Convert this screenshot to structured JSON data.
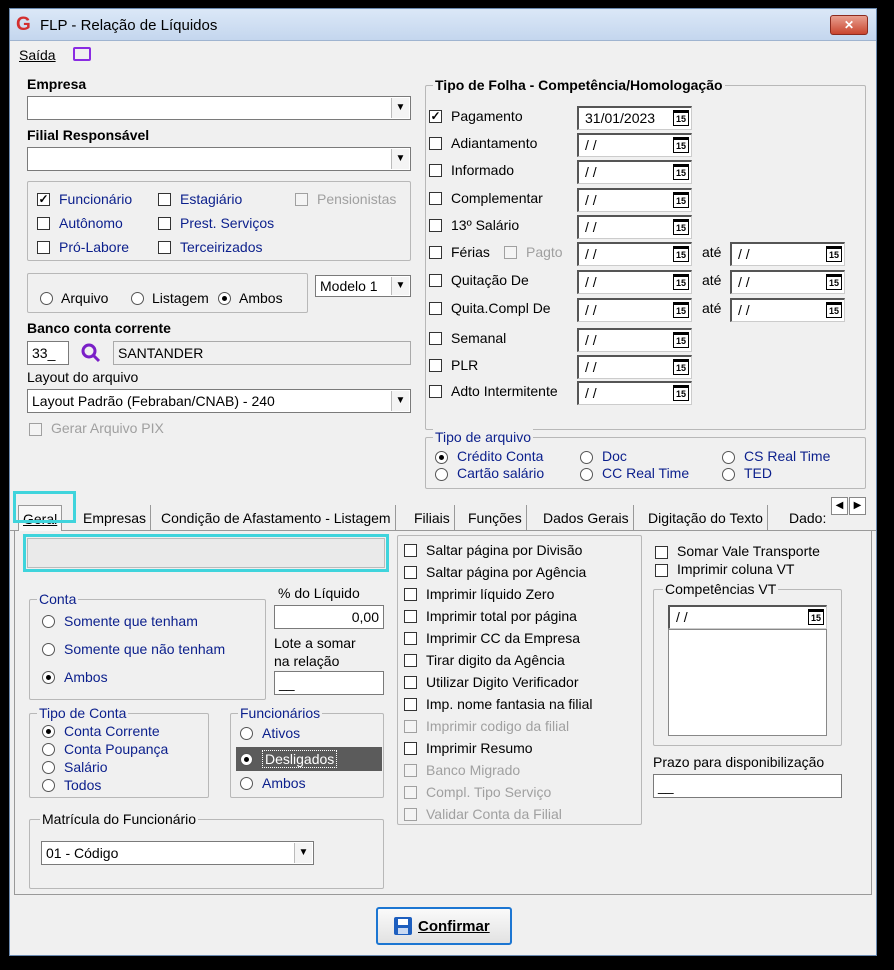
{
  "window": {
    "title": "FLP - Relação de Líquidos",
    "menu_saida": "Saída",
    "close": "✕"
  },
  "empresa": {
    "label": "Empresa",
    "value": ""
  },
  "filial": {
    "label": "Filial Responsável",
    "value": ""
  },
  "tipos": [
    {
      "label": "Funcionário",
      "checked": true
    },
    {
      "label": "Estagiário",
      "checked": false
    },
    {
      "label": "Pensionistas",
      "checked": false,
      "disabled": true
    },
    {
      "label": "Autônomo",
      "checked": false
    },
    {
      "label": "Prest. Serviços",
      "checked": false
    },
    {
      "label": "Pró-Labore",
      "checked": false
    },
    {
      "label": "Terceirizados",
      "checked": false
    }
  ],
  "saida": {
    "arquivo": "Arquivo",
    "listagem": "Listagem",
    "ambos": "Ambos",
    "selected": "Ambos",
    "modelo": "Modelo 1"
  },
  "banco": {
    "label": "Banco conta corrente",
    "code": "33_",
    "name": "SANTANDER"
  },
  "layout": {
    "label": "Layout do arquivo",
    "value": "Layout Padrão (Febraban/CNAB) - 240"
  },
  "pix": {
    "label": "Gerar Arquivo PIX"
  },
  "folha": {
    "title": "Tipo de Folha  -  Competência/Homologação",
    "ate": "até",
    "pagto": "Pagto",
    "rows": [
      {
        "label": "Pagamento",
        "checked": true,
        "date": "31/01/2023"
      },
      {
        "label": "Adiantamento",
        "checked": false,
        "date": " / /"
      },
      {
        "label": "Informado",
        "checked": false,
        "date": " / /"
      },
      {
        "label": "Complementar",
        "checked": false,
        "date": " / /"
      },
      {
        "label": "13º Salário",
        "checked": false,
        "date": " / /"
      },
      {
        "label": "Férias",
        "checked": false,
        "date": " / /",
        "date2": " / /"
      },
      {
        "label": "Quitação De",
        "checked": false,
        "date": " / /",
        "date2": " / /"
      },
      {
        "label": "Quita.Compl De",
        "checked": false,
        "date": " / /",
        "date2": " / /"
      },
      {
        "label": "Semanal",
        "checked": false,
        "date": " / /"
      },
      {
        "label": "PLR",
        "checked": false,
        "date": " / /"
      },
      {
        "label": "Adto Intermitente",
        "checked": false,
        "date": " / /"
      }
    ]
  },
  "tipo_arquivo": {
    "title": "Tipo de arquivo",
    "credito": "Crédito Conta",
    "cartao": "Cartão salário",
    "doc": "Doc",
    "ccreal": "CC Real Time",
    "csreal": "CS Real Time",
    "ted": "TED"
  },
  "tabs": [
    "Geral",
    "Empresas",
    "Condição de Afastamento - Listagem",
    "Filiais",
    "Funções",
    "Dados Gerais",
    "Digitação do Texto",
    "Dado:"
  ],
  "geral": {
    "conta": {
      "title": "Conta",
      "opt1": "Somente que tenham",
      "opt2": "Somente que não tenham",
      "opt3": "Ambos"
    },
    "pct": {
      "label": "% do Líquido",
      "value": "0,00"
    },
    "lote": {
      "label1": "Lote a somar",
      "label2": "na relação",
      "value": "__"
    },
    "tipoconta": {
      "title": "Tipo de Conta",
      "o1": "Conta Corrente",
      "o2": "Conta Poupança",
      "o3": "Salário",
      "o4": "Todos"
    },
    "func": {
      "title": "Funcionários",
      "o1": "Ativos",
      "o2": "Desligados",
      "o3": "Ambos"
    },
    "matricula": {
      "title": "Matrícula do Funcionário",
      "value": "01 - Código"
    },
    "opcoes": [
      {
        "label": "Saltar página por Divisão",
        "disabled": false
      },
      {
        "label": "Saltar página por Agência",
        "disabled": false
      },
      {
        "label": "Imprimir líquido Zero",
        "disabled": false
      },
      {
        "label": "Imprimir total por página",
        "disabled": false
      },
      {
        "label": "Imprimir CC da Empresa",
        "disabled": false
      },
      {
        "label": "Tirar digito da Agência",
        "disabled": false
      },
      {
        "label": "Utilizar Digito Verificador",
        "disabled": false
      },
      {
        "label": "Imp. nome fantasia na filial",
        "disabled": false
      },
      {
        "label": "Imprimir codigo da filial",
        "disabled": true
      },
      {
        "label": "Imprimir Resumo",
        "disabled": false
      },
      {
        "label": "Banco Migrado",
        "disabled": true
      },
      {
        "label": "Compl. Tipo Serviço",
        "disabled": true
      },
      {
        "label": "Validar Conta da Filial",
        "disabled": true
      }
    ],
    "vt": {
      "somar": "Somar Vale Transporte",
      "imprimir": "Imprimir coluna VT",
      "comp": "Competências VT",
      "date": " / /"
    },
    "prazo": {
      "label": "Prazo para disponibilização",
      "value": "__"
    }
  },
  "confirmar": "Confirmar",
  "colors": {
    "highlight": "#3fd4dc",
    "blue_text": "#0b1f8c",
    "logo": "#d32f2f"
  }
}
